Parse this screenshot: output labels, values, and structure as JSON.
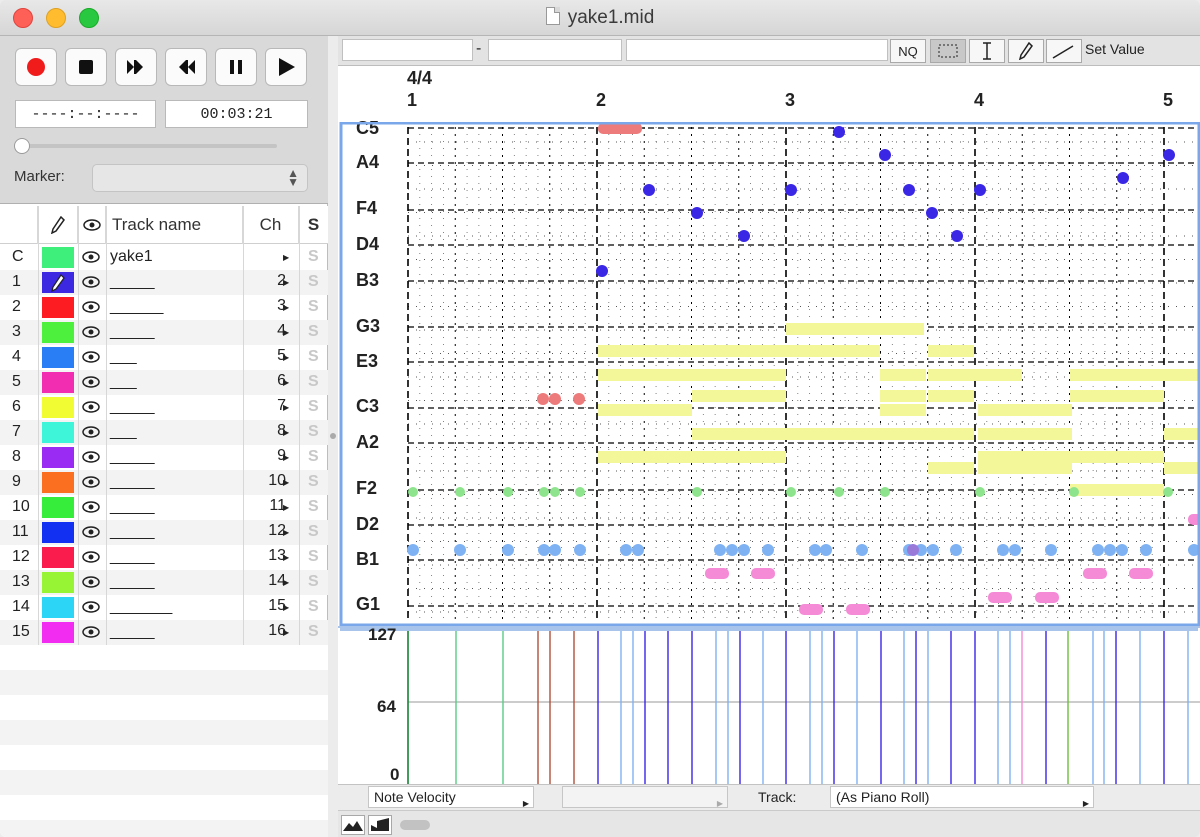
{
  "window": {
    "title": "yake1.mid"
  },
  "transport": {
    "position": "----:--:----",
    "time": "00:03:21",
    "marker_label": "Marker:",
    "marker_value": ""
  },
  "track_header": {
    "name": "Track name",
    "ch": "Ch",
    "solo": "S"
  },
  "tracks": [
    {
      "idx": "C",
      "color": "#3ef07b",
      "name": "yake1",
      "ch": "",
      "edit": false
    },
    {
      "idx": "1",
      "color": "#3b28e0",
      "name": "_____",
      "ch": "2",
      "edit": true
    },
    {
      "idx": "2",
      "color": "#fc1c22",
      "name": "______",
      "ch": "3",
      "edit": false
    },
    {
      "idx": "3",
      "color": "#4df03d",
      "name": "_____",
      "ch": "4",
      "edit": false
    },
    {
      "idx": "4",
      "color": "#2a7ef5",
      "name": "___",
      "ch": "5",
      "edit": false
    },
    {
      "idx": "5",
      "color": "#f32db1",
      "name": "___",
      "ch": "6",
      "edit": false
    },
    {
      "idx": "6",
      "color": "#f2fc32",
      "name": "_____",
      "ch": "7",
      "edit": false
    },
    {
      "idx": "7",
      "color": "#3ef5d9",
      "name": "___",
      "ch": "8",
      "edit": false
    },
    {
      "idx": "8",
      "color": "#9a2bf3",
      "name": "_____",
      "ch": "9",
      "edit": false
    },
    {
      "idx": "9",
      "color": "#fb6f20",
      "name": "_____",
      "ch": "10",
      "edit": false
    },
    {
      "idx": "10",
      "color": "#36ed3c",
      "name": "_____",
      "ch": "11",
      "edit": false
    },
    {
      "idx": "11",
      "color": "#1130f2",
      "name": "_____",
      "ch": "12",
      "edit": false
    },
    {
      "idx": "12",
      "color": "#fb1c4e",
      "name": "_____",
      "ch": "13",
      "edit": false
    },
    {
      "idx": "13",
      "color": "#96f434",
      "name": "_____",
      "ch": "14",
      "edit": false
    },
    {
      "idx": "14",
      "color": "#2cd4f6",
      "name": "_______",
      "ch": "15",
      "edit": false
    },
    {
      "idx": "15",
      "color": "#f32cf2",
      "name": "_____",
      "ch": "16",
      "edit": false
    }
  ],
  "toolbar": {
    "range_sep": "-",
    "note_tool": "NQ",
    "set_value": "Set Value"
  },
  "ruler": {
    "time_signature": "4/4",
    "bars": [
      "1",
      "2",
      "3",
      "4",
      "5"
    ]
  },
  "key_labels": [
    "C5",
    "A4",
    "F4",
    "D4",
    "B3",
    "G3",
    "E3",
    "C3",
    "A2",
    "F2",
    "D2",
    "B1",
    "G1"
  ],
  "velocity": {
    "labels": [
      "127",
      "64",
      "0"
    ]
  },
  "bottom": {
    "controller": "Note Velocity",
    "second_popup": "",
    "track_label": "Track:",
    "track_value": "(As Piano Roll)"
  },
  "colors": {
    "selection_border": "#7aa7ea",
    "note_blue": "#3a27e6",
    "note_yellow": "#f4f69a",
    "note_red": "#ee7b7b",
    "note_green": "#8ee48d",
    "note_lightblue": "#7fb2f3",
    "note_pink": "#f58ad6"
  }
}
